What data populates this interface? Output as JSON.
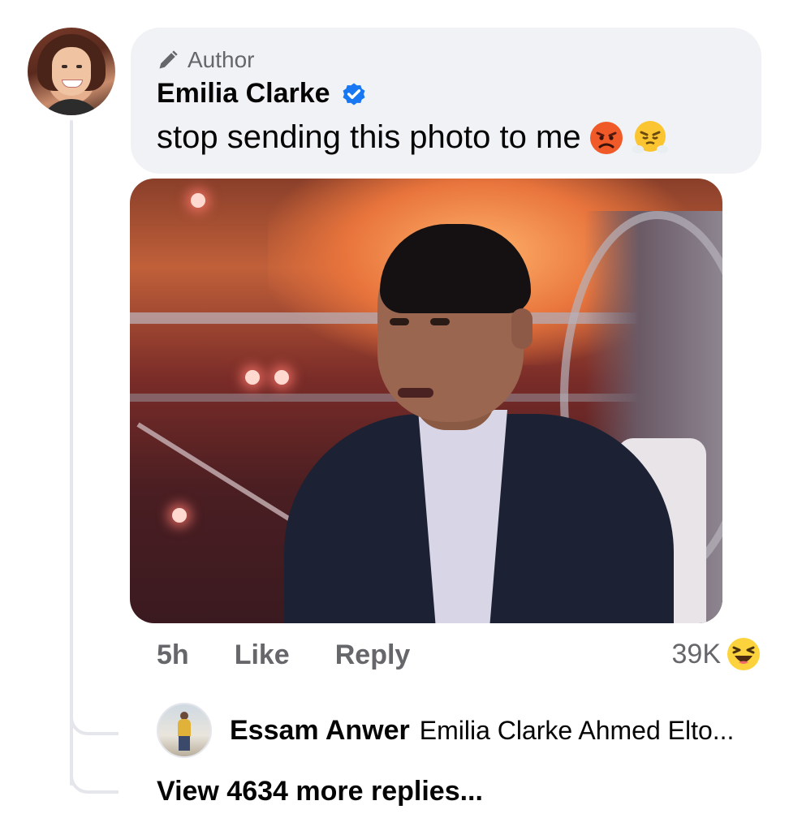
{
  "comment": {
    "author_tag": "Author",
    "name": "Emilia Clarke",
    "text": "stop sending this photo to me",
    "emojis": [
      "pouting-face",
      "face-with-steam"
    ],
    "verified": true
  },
  "actions": {
    "time": "5h",
    "like_label": "Like",
    "reply_label": "Reply",
    "reaction_count": "39K",
    "reaction_icon": "laughing-emoji"
  },
  "reply_preview": {
    "name": "Essam Anwer",
    "text": "Emilia Clarke Ahmed Elto..."
  },
  "more_replies_label": "View 4634 more replies...",
  "colors": {
    "bubble_bg": "#f0f2f5",
    "secondary_text": "#65676b",
    "verified_blue": "#1877f2",
    "thread_line": "#e4e6eb"
  }
}
